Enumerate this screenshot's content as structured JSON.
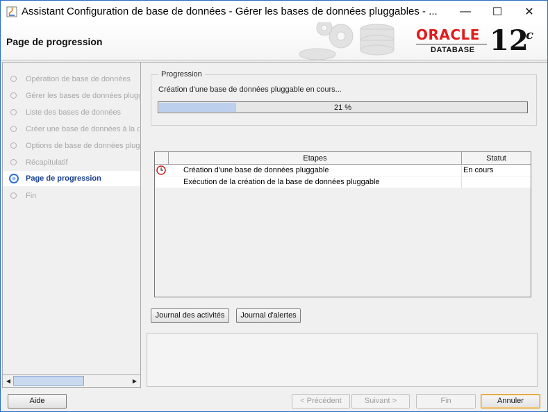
{
  "window": {
    "title": "Assistant Configuration de base de données - Gérer les bases de données pluggables - ...",
    "minimize": "—",
    "maximize": "☐",
    "close": "✕"
  },
  "header": {
    "page_title": "Page de progression",
    "brand": "ORACLE",
    "product": "DATABASE",
    "version": "12",
    "version_suffix": "c"
  },
  "sidebar": {
    "items": [
      {
        "label": "Opération de base de données",
        "active": false
      },
      {
        "label": "Gérer les bases de données pluggables",
        "active": false
      },
      {
        "label": "Liste des bases de données",
        "active": false
      },
      {
        "label": "Créer une base de données à la demande",
        "active": false
      },
      {
        "label": "Options de base de données pluggable",
        "active": false
      },
      {
        "label": "Récapitulatif",
        "active": false
      },
      {
        "label": "Page de progression",
        "active": true
      },
      {
        "label": "Fin",
        "active": false
      }
    ],
    "scroll_left": "◀",
    "scroll_right": "▶"
  },
  "progress": {
    "group_label": "Progression",
    "status_text": "Création d'une base de données pluggable en cours...",
    "percent": 21,
    "percent_label": "21 %"
  },
  "steps_table": {
    "headers": [
      "Etapes",
      "Statut"
    ],
    "rows": [
      {
        "step": "Création d'une base de données pluggable",
        "status": "En cours",
        "icon": "clock-icon"
      },
      {
        "step": "Exécution de la création de la base de données pluggable",
        "status": "",
        "icon": ""
      }
    ]
  },
  "log_buttons": {
    "activity_log": "Journal des activités",
    "alert_log": "Journal d'alertes"
  },
  "footer": {
    "help": "Aide",
    "previous": "< Précédent",
    "next": "Suivant >",
    "finish": "Fin",
    "cancel": "Annuler"
  },
  "colors": {
    "accent": "#2f6fd0",
    "brand_red": "#e01b1b",
    "progress_fill": "#bcd0ee"
  }
}
